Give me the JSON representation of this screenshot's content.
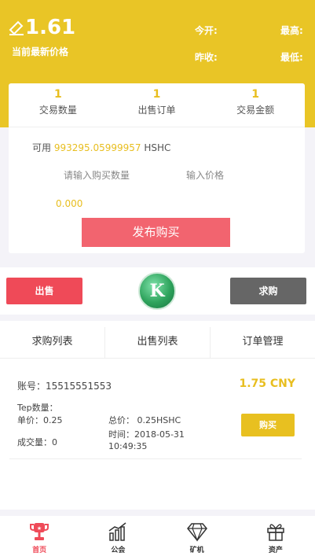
{
  "header": {
    "price": "1.61",
    "price_label": "当前最新价格",
    "open_label": "今开:",
    "high_label": "最高:",
    "prev_close_label": "昨收:",
    "low_label": "最低:"
  },
  "stats": [
    {
      "value": "1",
      "label": "交易数量"
    },
    {
      "value": "1",
      "label": "出售订单"
    },
    {
      "value": "1",
      "label": "交易金额"
    }
  ],
  "form": {
    "available_prefix": "可用",
    "available_amount": "993295.05999957",
    "available_unit": "HSHC",
    "qty_placeholder": "请输入购买数量",
    "price_placeholder": "输入价格",
    "total": "0.000",
    "publish_label": "发布购买"
  },
  "actions": {
    "sell_label": "出售",
    "logo_letter": "K",
    "buy_label": "求购"
  },
  "tabs": [
    "求购列表",
    "出售列表",
    "订单管理"
  ],
  "order": {
    "account": "账号：15515551553",
    "price": "1.75 CNY",
    "tep_qty": "Tep数量：",
    "unit_price": "单价：0.25",
    "total_price": "总价：  0.25HSHC",
    "deal_qty": "成交量：0",
    "time": "时间：2018-05-31",
    "time2": "10:49:35",
    "buy_label": "购买"
  },
  "nav": [
    {
      "label": "首页",
      "icon": "trophy-icon"
    },
    {
      "label": "公会",
      "icon": "chart-icon"
    },
    {
      "label": "矿机",
      "icon": "diamond-icon"
    },
    {
      "label": "资产",
      "icon": "gift-icon"
    }
  ],
  "colors": {
    "brand_yellow": "#e9c526",
    "accent_gold": "#e8be1f",
    "sell_red": "#ef4a58",
    "publish_pink": "#f2646f",
    "buy_gray": "#666666"
  }
}
